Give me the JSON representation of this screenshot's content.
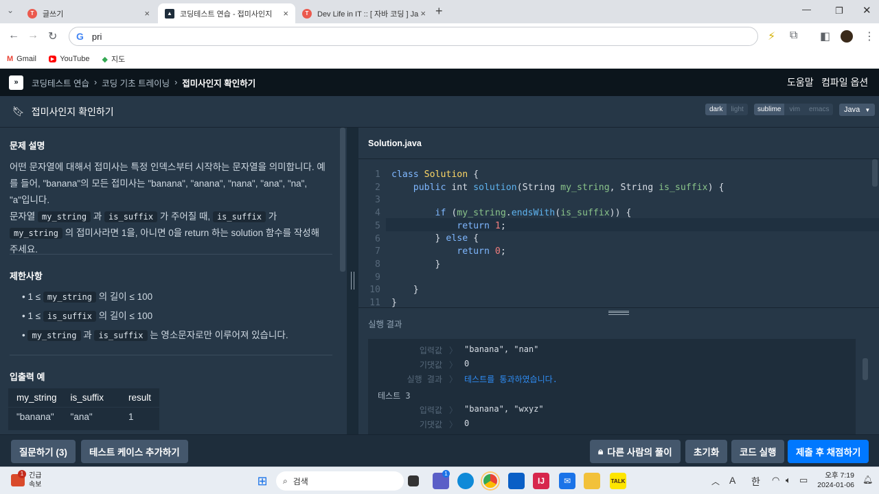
{
  "browser": {
    "tabs": [
      {
        "title": "글쓰기",
        "active": false
      },
      {
        "title": "코딩테스트 연습 - 접미사인지",
        "active": true
      },
      {
        "title": "Dev Life in IT :: [ 자바 코딩 ] Ja",
        "active": false
      }
    ],
    "new_tab": "+",
    "address": "pri",
    "bookmarks": [
      "Gmail",
      "YouTube",
      "지도"
    ]
  },
  "app": {
    "breadcrumb": [
      "코딩테스트 연습",
      "코딩 기초 트레이닝",
      "접미사인지 확인하기"
    ],
    "nav_help": "도움말",
    "nav_compile": "컴파일 옵션",
    "page_title": "접미사인지 확인하기",
    "themes": [
      "dark",
      "light"
    ],
    "keymaps": [
      "sublime",
      "vim",
      "emacs"
    ],
    "language": "Java",
    "problem": {
      "section_title": "문제 설명",
      "para1": "어떤 문자열에 대해서 접미사는 특정 인덱스부터 시작하는 문자열을 의미합니다. 예를 들어, \"banana\"의 모든 접미사는 \"banana\", \"anana\", \"nana\", \"ana\", \"na\", \"a\"입니다.",
      "p2_a": "문자열",
      "p2_code1": "my_string",
      "p2_b": "과",
      "p2_code2": "is_suffix",
      "p2_c": "가 주어질 때,",
      "p2_code3": "is_suffix",
      "p2_d": "가",
      "p2_code4": "my_string",
      "p2_e": "의 접미사라면 1을, 아니면 0을 return 하는 solution 함수를 작성해 주세요.",
      "constraints_title": "제한사항",
      "c1_a": "1 ≤",
      "c1_code": "my_string",
      "c1_b": "의 길이 ≤ 100",
      "c2_a": "1 ≤",
      "c2_code": "is_suffix",
      "c2_b": "의 길이 ≤ 100",
      "c3_code1": "my_string",
      "c3_a": "과",
      "c3_code2": "is_suffix",
      "c3_b": "는 영소문자로만 이루어져 있습니다.",
      "examples_title": "입출력 예",
      "table_headers": [
        "my_string",
        "is_suffix",
        "result"
      ],
      "table_row": [
        "\"banana\"",
        "\"ana\"",
        "1"
      ]
    },
    "editor": {
      "filename": "Solution.java",
      "line_numbers": [
        "1",
        "2",
        "3",
        "4",
        "5",
        "6",
        "7",
        "8",
        "9",
        "10",
        "11"
      ]
    },
    "results": {
      "header": "실행 결과",
      "input_label": "입력값",
      "expected_label": "기댓값",
      "result_label": "실행 결과",
      "t2_input": "\"banana\", \"nan\"",
      "t2_expected": "0",
      "t2_result": "테스트를 통과하였습니다.",
      "t3_title": "테스트 3",
      "t3_input": "\"banana\", \"wxyz\"",
      "t3_expected": "0"
    },
    "footer": {
      "ask": "질문하기 (3)",
      "add_case": "테스트 케이스 추가하기",
      "others": "다른 사람의 풀이",
      "reset": "초기화",
      "run": "코드 실행",
      "submit": "제출 후 채점하기"
    }
  },
  "taskbar": {
    "news_title": "긴급",
    "news_sub": "속보",
    "news_badge": "1",
    "search": "검색",
    "chat_badge": "1",
    "ime_a": "A",
    "ime_han": "한",
    "time": "오후 7:19",
    "date": "2024-01-06"
  }
}
